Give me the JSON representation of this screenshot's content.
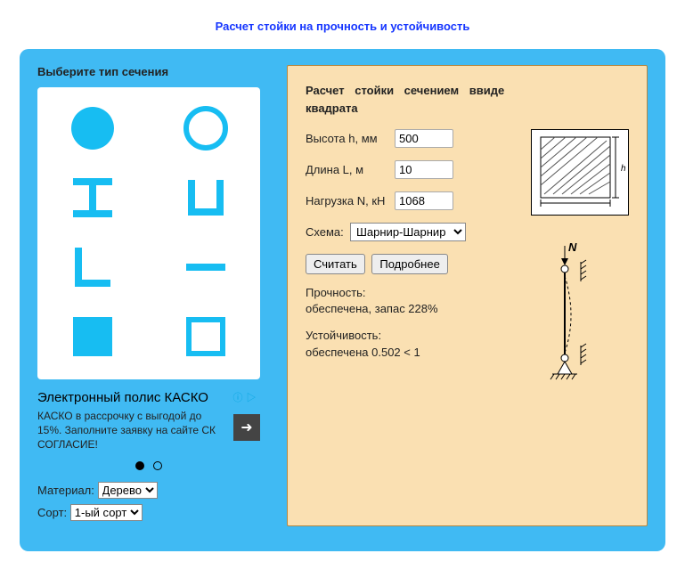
{
  "page": {
    "title": "Расчет стойки на прочность и устойчивость"
  },
  "left": {
    "section_title": "Выберите тип сечения",
    "shapes": [
      {
        "name": "circle-solid"
      },
      {
        "name": "circle-hollow"
      },
      {
        "name": "i-beam"
      },
      {
        "name": "channel"
      },
      {
        "name": "angle"
      },
      {
        "name": "bar-horizontal"
      },
      {
        "name": "square-solid"
      },
      {
        "name": "square-hollow"
      }
    ],
    "ad": {
      "title": "Электронный полис КАСКО",
      "text": "КАСКО в рассрочку с выгодой до 15%. Заполните заявку на сайте СК СОГЛАСИЕ!",
      "info_label": "ⓘ ▷",
      "arrow": "➜"
    },
    "material_label": "Материал:",
    "material_options": [
      "Дерево"
    ],
    "material_value": "Дерево",
    "sort_label": "Сорт:",
    "sort_options": [
      "1-ый сорт"
    ],
    "sort_value": "1-ый сорт"
  },
  "right": {
    "title": "Расчет стойки сечением ввиде квадрата",
    "height_label": "Высота h, мм",
    "height_value": "500",
    "length_label": "Длина L, м",
    "length_value": "10",
    "load_label": "Нагрузка N, кН",
    "load_value": "1068",
    "scheme_label": "Схема:",
    "scheme_options": [
      "Шарнир-Шарнир"
    ],
    "scheme_value": "Шарнир-Шарнир",
    "btn_calc": "Считать",
    "btn_more": "Подробнее",
    "strength_label": "Прочность:",
    "strength_value": " обеспечена, запас 228%",
    "stability_label": "Устойчивость:",
    "stability_value": " обеспечена 0.502 < 1",
    "diag_n": "N",
    "diag_h": "h"
  }
}
